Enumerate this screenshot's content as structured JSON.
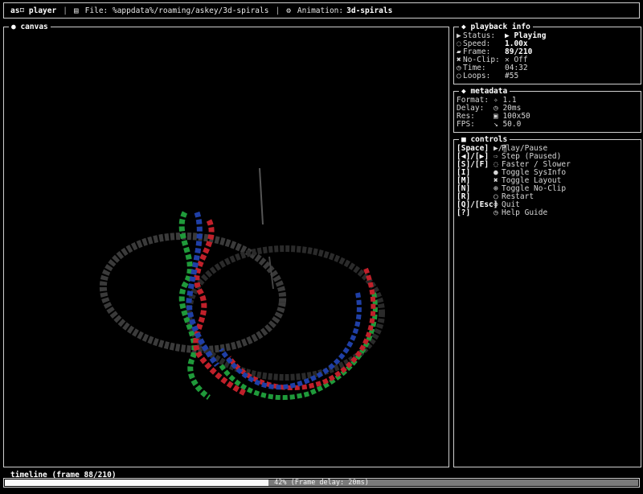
{
  "header": {
    "app_name": "as⌑ player",
    "sep1": "|",
    "file_icon": "file-icon",
    "file_label": "File: %appdata%/roaming/askey/3d-spirals",
    "sep2": "|",
    "anim_icon": "gear-icon",
    "anim_label": "Animation:",
    "anim_name": "3d-spirals"
  },
  "canvas": {
    "title": "● canvas"
  },
  "playback": {
    "title": "◆ playback info",
    "rows": [
      {
        "icon": "▶",
        "key": "Status:",
        "val": "▶ Playing",
        "bold": true
      },
      {
        "icon": "◌",
        "key": "Speed:",
        "val": "1.00x",
        "bold": true
      },
      {
        "icon": "▰",
        "key": "Frame:",
        "val": "89/210",
        "bold": true
      },
      {
        "icon": "✖",
        "key": "No-Clip:",
        "val": "✕ Off",
        "bold": false
      },
      {
        "icon": "◷",
        "key": "Time:",
        "val": "04:32",
        "bold": false
      },
      {
        "icon": "○",
        "key": "Loops:",
        "val": "#55",
        "bold": false
      }
    ]
  },
  "metadata": {
    "title": "◆ metadata",
    "rows": [
      {
        "key": "Format:",
        "val": "✧ 1.1"
      },
      {
        "key": "Delay:",
        "val": "◷ 20ms"
      },
      {
        "key": "Res:",
        "val": "▣ 100x50"
      },
      {
        "key": "FPS:",
        "val": "↘ 50.0"
      }
    ]
  },
  "controls": {
    "title": "■ controls",
    "rows": [
      {
        "key": "[Space]",
        "icon": "▶/‖",
        "label": "Play/Pause"
      },
      {
        "key": "[◀]/[▶]",
        "icon": "⇨",
        "label": "Step (Paused)"
      },
      {
        "key": "[S]/[F]",
        "icon": "◌",
        "label": "Faster / Slower"
      },
      {
        "key": "[I]",
        "icon": "●",
        "label": "Toggle SysInfo"
      },
      {
        "key": "[M]",
        "icon": "✖",
        "label": "Toggle Layout"
      },
      {
        "key": "[N]",
        "icon": "⊕",
        "label": "Toggle No-Clip"
      },
      {
        "key": "[R]",
        "icon": "○",
        "label": "Restart"
      },
      {
        "key": "[Q]/[Esc]",
        "icon": "⊗",
        "label": "Quit"
      },
      {
        "key": "[?]",
        "icon": "◷",
        "label": "Help Guide"
      }
    ]
  },
  "timeline": {
    "title": "timeline (frame 88/210)",
    "progress_text": "42% (Frame delay: 20ms)",
    "progress": 0.42
  },
  "colors": {
    "border": "#cfcfcf",
    "bg": "#000000",
    "red": "#c0202a",
    "green": "#1f9a3a",
    "blue": "#1f3fa6"
  }
}
